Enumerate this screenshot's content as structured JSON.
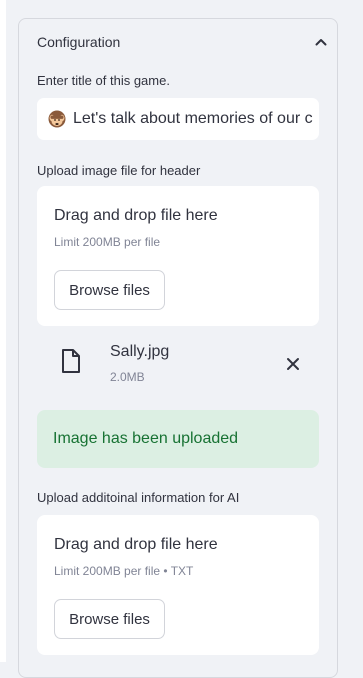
{
  "expander": {
    "title": "Configuration",
    "chevron_icon": "chevron-up-icon"
  },
  "game_title": {
    "label": "Enter title of this game.",
    "emoji_icon": "monkey-emoji-icon",
    "value": "Let's talk about memories of our c"
  },
  "header_upload": {
    "label": "Upload image file for header",
    "dropzone_title": "Drag and drop file here",
    "limit": "Limit 200MB per file",
    "browse_label": "Browse files",
    "file": {
      "icon": "file-icon",
      "name": "Sally.jpg",
      "size": "2.0MB",
      "remove_icon": "close-icon"
    }
  },
  "alert": {
    "text": "Image has been uploaded"
  },
  "ai_upload": {
    "label": "Upload additoinal information for AI",
    "dropzone_title": "Drag and drop file here",
    "limit": "Limit 200MB per file • TXT",
    "browse_label": "Browse files"
  },
  "colors": {
    "background": "#f0f2f6",
    "surface": "#ffffff",
    "text": "#31333f",
    "muted": "#808495",
    "success_bg": "#dcefe3",
    "success_text": "#177233"
  }
}
